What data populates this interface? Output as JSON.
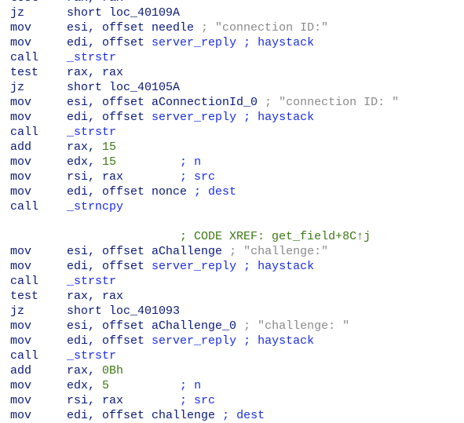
{
  "colors": {
    "mnemonic": "#0a1a7a",
    "name": "#1a2ee6",
    "number": "#3c7a14",
    "comment": "#8a8a8a"
  },
  "lines": [
    [
      {
        "t": "test    ",
        "c": "k"
      },
      {
        "t": "rax, rax",
        "c": "k"
      }
    ],
    [
      {
        "t": "jz      ",
        "c": "k"
      },
      {
        "t": "short loc_40109A",
        "c": "k"
      }
    ],
    [
      {
        "t": "mov     ",
        "c": "k"
      },
      {
        "t": "esi, offset needle ",
        "c": "k"
      },
      {
        "t": "; \"connection ID:\"",
        "c": "c"
      }
    ],
    [
      {
        "t": "mov     ",
        "c": "k"
      },
      {
        "t": "edi, offset ",
        "c": "k"
      },
      {
        "t": "server_reply ; haystack",
        "c": "b"
      }
    ],
    [
      {
        "t": "call    ",
        "c": "k"
      },
      {
        "t": "_strstr",
        "c": "b"
      }
    ],
    [
      {
        "t": "test    ",
        "c": "k"
      },
      {
        "t": "rax, rax",
        "c": "k"
      }
    ],
    [
      {
        "t": "jz      ",
        "c": "k"
      },
      {
        "t": "short loc_40105A",
        "c": "k"
      }
    ],
    [
      {
        "t": "mov     ",
        "c": "k"
      },
      {
        "t": "esi, offset aConnectionId_0 ",
        "c": "k"
      },
      {
        "t": "; \"connection ID: \"",
        "c": "c"
      }
    ],
    [
      {
        "t": "mov     ",
        "c": "k"
      },
      {
        "t": "edi, offset ",
        "c": "k"
      },
      {
        "t": "server_reply ; haystack",
        "c": "b"
      }
    ],
    [
      {
        "t": "call    ",
        "c": "k"
      },
      {
        "t": "_strstr",
        "c": "b"
      }
    ],
    [
      {
        "t": "add     ",
        "c": "k"
      },
      {
        "t": "rax, ",
        "c": "k"
      },
      {
        "t": "15",
        "c": "g"
      }
    ],
    [
      {
        "t": "mov     ",
        "c": "k"
      },
      {
        "t": "edx, ",
        "c": "k"
      },
      {
        "t": "15",
        "c": "g"
      },
      {
        "t": "         ; n",
        "c": "b"
      }
    ],
    [
      {
        "t": "mov     ",
        "c": "k"
      },
      {
        "t": "rsi, rax",
        "c": "k"
      },
      {
        "t": "        ; src",
        "c": "b"
      }
    ],
    [
      {
        "t": "mov     ",
        "c": "k"
      },
      {
        "t": "edi, offset nonce ",
        "c": "k"
      },
      {
        "t": "; dest",
        "c": "b"
      }
    ],
    [
      {
        "t": "call    ",
        "c": "k"
      },
      {
        "t": "_strncpy",
        "c": "b"
      }
    ],
    [],
    [
      {
        "t": "                        ; CODE XREF: get_field+8C↑j",
        "c": "g"
      }
    ],
    [
      {
        "t": "mov     ",
        "c": "k"
      },
      {
        "t": "esi, offset aChallenge ",
        "c": "k"
      },
      {
        "t": "; \"challenge:\"",
        "c": "c"
      }
    ],
    [
      {
        "t": "mov     ",
        "c": "k"
      },
      {
        "t": "edi, offset ",
        "c": "k"
      },
      {
        "t": "server_reply ; haystack",
        "c": "b"
      }
    ],
    [
      {
        "t": "call    ",
        "c": "k"
      },
      {
        "t": "_strstr",
        "c": "b"
      }
    ],
    [
      {
        "t": "test    ",
        "c": "k"
      },
      {
        "t": "rax, rax",
        "c": "k"
      }
    ],
    [
      {
        "t": "jz      ",
        "c": "k"
      },
      {
        "t": "short loc_401093",
        "c": "k"
      }
    ],
    [
      {
        "t": "mov     ",
        "c": "k"
      },
      {
        "t": "esi, offset aChallenge_0 ",
        "c": "k"
      },
      {
        "t": "; \"challenge: \"",
        "c": "c"
      }
    ],
    [
      {
        "t": "mov     ",
        "c": "k"
      },
      {
        "t": "edi, offset ",
        "c": "k"
      },
      {
        "t": "server_reply ; haystack",
        "c": "b"
      }
    ],
    [
      {
        "t": "call    ",
        "c": "k"
      },
      {
        "t": "_strstr",
        "c": "b"
      }
    ],
    [
      {
        "t": "add     ",
        "c": "k"
      },
      {
        "t": "rax, ",
        "c": "k"
      },
      {
        "t": "0Bh",
        "c": "g"
      }
    ],
    [
      {
        "t": "mov     ",
        "c": "k"
      },
      {
        "t": "edx, ",
        "c": "k"
      },
      {
        "t": "5",
        "c": "g"
      },
      {
        "t": "          ; n",
        "c": "b"
      }
    ],
    [
      {
        "t": "mov     ",
        "c": "k"
      },
      {
        "t": "rsi, rax",
        "c": "k"
      },
      {
        "t": "        ; src",
        "c": "b"
      }
    ],
    [
      {
        "t": "mov     ",
        "c": "k"
      },
      {
        "t": "edi, offset challenge ",
        "c": "k"
      },
      {
        "t": "; dest",
        "c": "b"
      }
    ]
  ]
}
